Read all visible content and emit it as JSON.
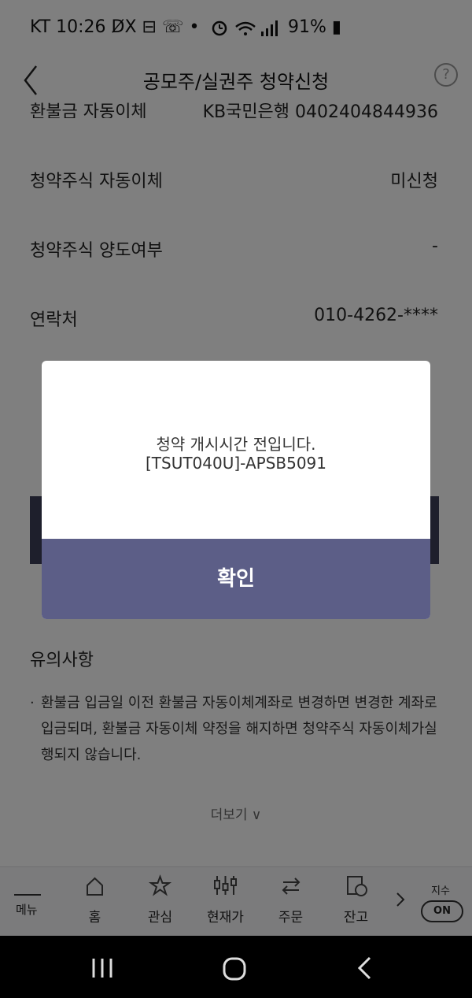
{
  "status_bar": {
    "left_text": "KT 10:26 D̸X ⊟ ☏ •",
    "battery": "91%",
    "icons": [
      "alarm-icon",
      "wifi-icon",
      "signal-icon",
      "battery-icon"
    ]
  },
  "header": {
    "title": "공모주/실권주 청약신청",
    "help_label": "?"
  },
  "rows": [
    {
      "label": "환불금 자동이체",
      "value": "KB국민은행 0402404844936"
    },
    {
      "label": "청약주식 자동이체",
      "value": "미신청"
    },
    {
      "label": "청약주식 양도여부",
      "value": "-"
    },
    {
      "label": "연락처",
      "value": "010-4262-****"
    }
  ],
  "notice": {
    "title": "유의사항",
    "bullet": "·",
    "text": "환불금 입금일 이전 환불금 자동이체계좌로 변경하면 변경한 계좌로 입금되며, 환불금 자동이체 약정을 해지하면 청약주식 자동이체가실행되지 않습니다."
  },
  "more_label": "더보기 ∨",
  "tabbar": {
    "menu_label": "메뉴",
    "tabs": [
      {
        "label": "홈",
        "icon": "home-icon"
      },
      {
        "label": "관심",
        "icon": "star-icon"
      },
      {
        "label": "현재가",
        "icon": "candlestick-icon"
      },
      {
        "label": "주문",
        "icon": "swap-icon"
      },
      {
        "label": "잔고",
        "icon": "balance-icon"
      }
    ],
    "index_label": "지수",
    "index_toggle": "ON"
  },
  "dialog": {
    "message_line1": "청약 개시시간 전입니다.",
    "message_line2": "[TSUT040U]-APSB5091",
    "confirm_label": "확인"
  },
  "colors": {
    "dialog_button": "#5c5e87",
    "dark_bar": "#3c3f59",
    "overlay": "rgba(0,0,0,0.5)"
  }
}
